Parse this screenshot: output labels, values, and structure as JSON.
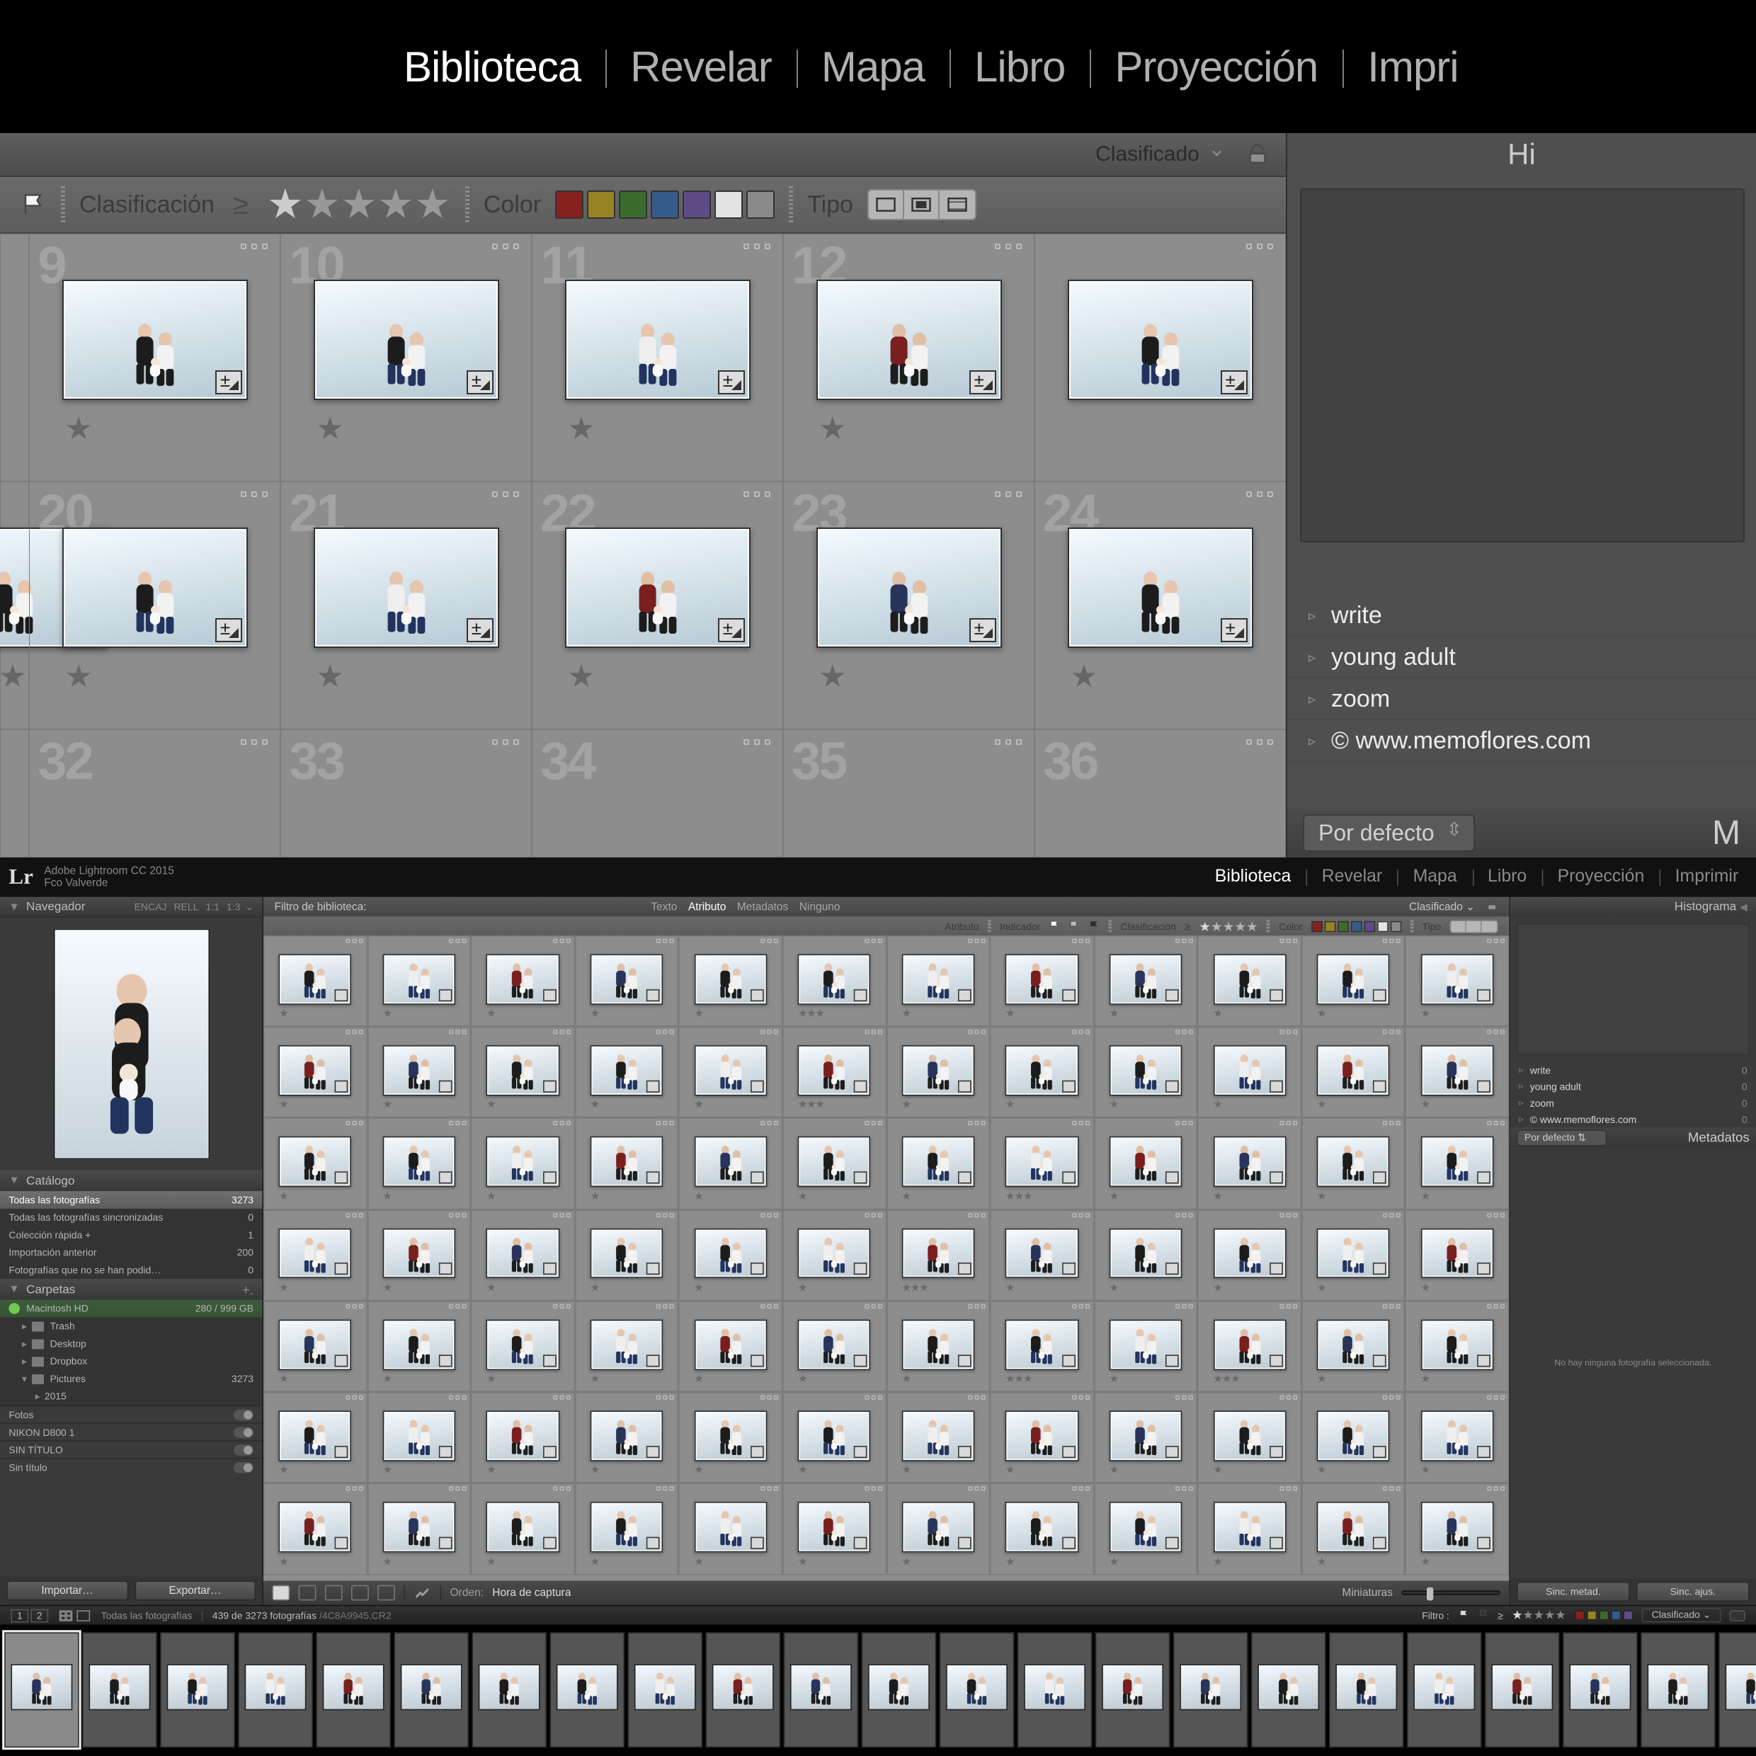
{
  "upper": {
    "modules": [
      "Biblioteca",
      "Revelar",
      "Mapa",
      "Libro",
      "Proyección",
      "Impri"
    ],
    "active_module_index": 0,
    "filter_preset_label": "Clasificado",
    "attr_bar": {
      "rating_label": "Clasificación",
      "color_label": "Color",
      "type_label": "Tipo",
      "swatches": [
        "red",
        "yel",
        "grn",
        "blu",
        "pur",
        "wht",
        "gry"
      ]
    },
    "right": {
      "histogram_title": "Hi",
      "keywords": [
        "write",
        "young adult",
        "zoom",
        "© www.memoflores.com"
      ],
      "meta_preset": "Por defecto",
      "meta_title": "M"
    },
    "grid_rows": {
      "r1_indices": [
        "9",
        "10",
        "11",
        "12"
      ],
      "r2_indices": [
        "20",
        "21",
        "22",
        "23",
        "24"
      ],
      "r3_indices": [
        "32",
        "33",
        "34",
        "35",
        "36"
      ]
    }
  },
  "lower": {
    "app_title_line1": "Adobe Lightroom CC 2015",
    "app_title_line2": "Fco Valverde",
    "modules": [
      "Biblioteca",
      "Revelar",
      "Mapa",
      "Libro",
      "Proyección",
      "Imprimir"
    ],
    "active_module_index": 0,
    "left": {
      "navigator_label": "Navegador",
      "nav_modes": [
        "ENCAJ",
        "RELL",
        "1:1",
        "1:3"
      ],
      "catalog_label": "Catálogo",
      "catalog_items": [
        {
          "label": "Todas las fotografías",
          "count": "3273",
          "active": true
        },
        {
          "label": "Todas las fotografías sincronizadas",
          "count": "0"
        },
        {
          "label": "Colección rápida  +",
          "count": "1"
        },
        {
          "label": "Importación anterior",
          "count": "200"
        },
        {
          "label": "Fotografías que no se han podid…",
          "count": "0"
        }
      ],
      "folders_label": "Carpetas",
      "volume": {
        "name": "Macintosh HD",
        "usage": "280 / 999 GB"
      },
      "folders": [
        {
          "label": "Trash",
          "count": "",
          "depth": 1
        },
        {
          "label": "Desktop",
          "count": "",
          "depth": 1
        },
        {
          "label": "Dropbox",
          "count": "",
          "depth": 1
        },
        {
          "label": "Pictures",
          "count": "3273",
          "depth": 1,
          "open": true
        },
        {
          "label": "2015",
          "count": "",
          "depth": 2
        }
      ],
      "extra_rows": [
        "Fotos",
        "NIKON D800 1",
        "SIN TÍTULO",
        "Sin título"
      ],
      "import_btn": "Importar…",
      "export_btn": "Exportar…"
    },
    "center": {
      "filter_title": "Filtro de biblioteca:",
      "tabs": [
        "Texto",
        "Atributo",
        "Metadatos",
        "Ninguno"
      ],
      "active_tab_index": 1,
      "filter_preset": "Clasificado",
      "attr": {
        "attribute_label": "Atributo",
        "indicator_label": "Indicador",
        "rating_label": "Clasificación",
        "color_label": "Color",
        "type_label": "Tipo",
        "swatches": [
          "red",
          "yel",
          "grn",
          "blu",
          "pur",
          "wht",
          "gry"
        ]
      },
      "grid_count": 84,
      "starred_rows": [
        5,
        17,
        31,
        42,
        55,
        57
      ],
      "toolbar": {
        "orden_label": "Orden:",
        "orden_value": "Hora de captura",
        "thumb_label": "Miniaturas"
      }
    },
    "right": {
      "histogram_label": "Histograma",
      "keywords": [
        {
          "label": "write",
          "count": "0"
        },
        {
          "label": "young adult",
          "count": "0"
        },
        {
          "label": "zoom",
          "count": "0"
        },
        {
          "label": "© www.memoflores.com",
          "count": "0"
        }
      ],
      "meta_preset": "Por defecto",
      "meta_title": "Metadatos",
      "empty_text": "No hay ninguna fotografía seleccionada.",
      "sync_meta_btn": "Sinc. metad.",
      "sync_settings_btn": "Sinc. ajus."
    },
    "infobar": {
      "breadcrumb": "Todas las fotografías",
      "status": "439 de 3273 fotografías",
      "filename": "/4C8A9945.CR2",
      "filter_label": "Filtro :",
      "preset_label": "Clasificado"
    },
    "filmstrip_count": 23,
    "filmstrip_selected": 0
  }
}
